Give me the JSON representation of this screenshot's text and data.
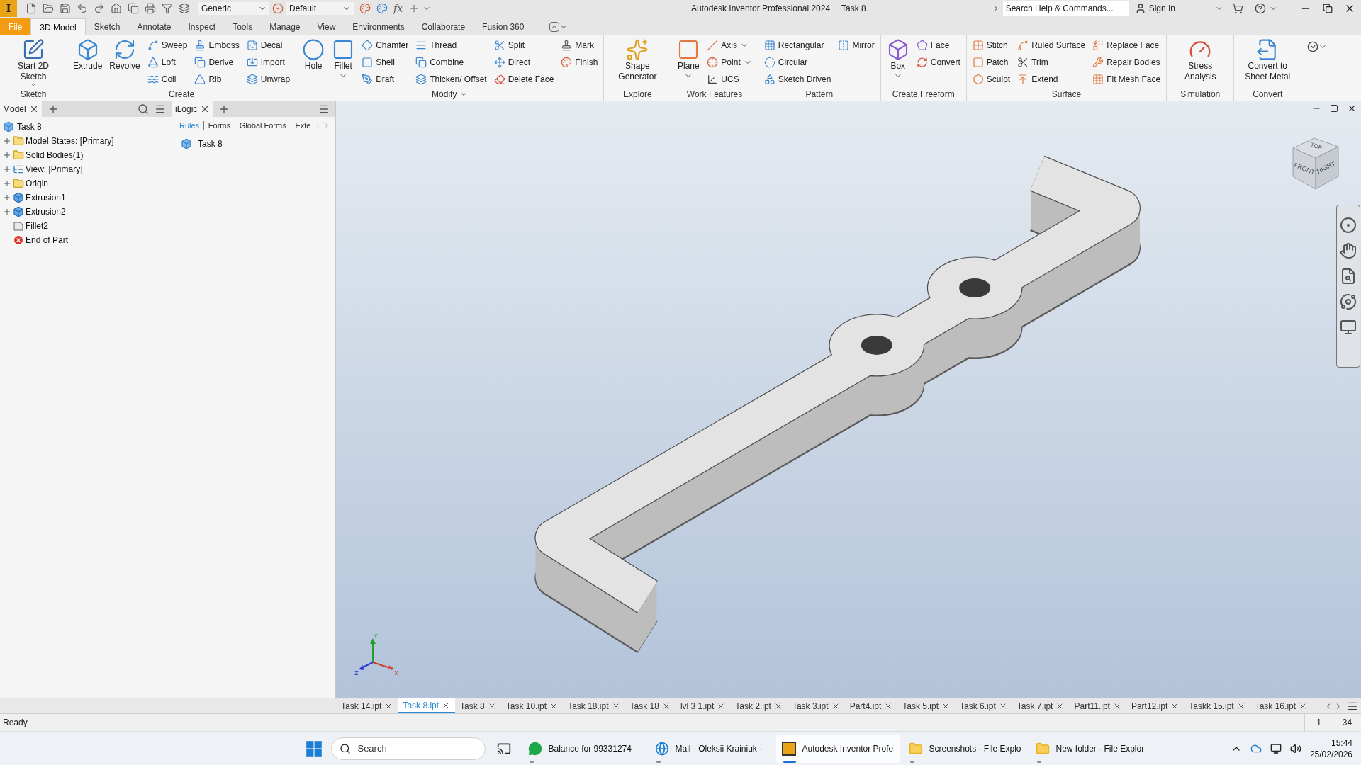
{
  "title_bar": {
    "logo_letter": "I",
    "material": "Generic",
    "appearance": "Default",
    "function_button": "fx",
    "app_title": "Autodesk Inventor Professional 2024",
    "document": "Task 8",
    "search": {
      "placeholder": "Search Help & Commands..."
    },
    "sign_in": "Sign In"
  },
  "ribbon_tabs": [
    {
      "label": "File",
      "kind": "file",
      "selected": false
    },
    {
      "label": "3D Model",
      "kind": "tab",
      "selected": true
    },
    {
      "label": "Sketch",
      "kind": "tab",
      "selected": false
    },
    {
      "label": "Annotate",
      "kind": "tab",
      "selected": false
    },
    {
      "label": "Inspect",
      "kind": "tab",
      "selected": false
    },
    {
      "label": "Tools",
      "kind": "tab",
      "selected": false
    },
    {
      "label": "Manage",
      "kind": "tab",
      "selected": false
    },
    {
      "label": "View",
      "kind": "tab",
      "selected": false
    },
    {
      "label": "Environments",
      "kind": "tab",
      "selected": false
    },
    {
      "label": "Collaborate",
      "kind": "tab",
      "selected": false
    },
    {
      "label": "Fusion 360",
      "kind": "tab",
      "selected": false
    }
  ],
  "ribbon_panels": [
    {
      "title": "Sketch",
      "menu": false,
      "columns": [
        [
          {
            "label": "Start 2D Sketch",
            "kind": "large-menu"
          }
        ]
      ]
    },
    {
      "title": "Create",
      "menu": false,
      "columns": [
        [
          {
            "label": "Extrude",
            "kind": "large"
          }
        ],
        [
          {
            "label": "Revolve",
            "kind": "large"
          }
        ],
        [
          {
            "label": "Sweep",
            "kind": "small"
          },
          {
            "label": "Loft",
            "kind": "small"
          },
          {
            "label": "Coil",
            "kind": "small"
          }
        ],
        [
          {
            "label": "Emboss",
            "kind": "small"
          },
          {
            "label": "Derive",
            "kind": "small"
          },
          {
            "label": "Rib",
            "kind": "small"
          }
        ],
        [
          {
            "label": "Decal",
            "kind": "small"
          },
          {
            "label": "Import",
            "kind": "small"
          },
          {
            "label": "Unwrap",
            "kind": "small"
          }
        ]
      ]
    },
    {
      "title": "Modify",
      "menu": true,
      "columns": [
        [
          {
            "label": "Hole",
            "kind": "large"
          }
        ],
        [
          {
            "label": "Fillet",
            "kind": "large-menu"
          }
        ],
        [
          {
            "label": "Chamfer",
            "kind": "small"
          },
          {
            "label": "Shell",
            "kind": "small"
          },
          {
            "label": "Draft",
            "kind": "small"
          }
        ],
        [
          {
            "label": "Thread",
            "kind": "small"
          },
          {
            "label": "Combine",
            "kind": "small"
          },
          {
            "label": "Thicken/ Offset",
            "kind": "small"
          }
        ],
        [
          {
            "label": "Split",
            "kind": "small"
          },
          {
            "label": "Direct",
            "kind": "small"
          },
          {
            "label": "Delete Face",
            "kind": "small"
          }
        ],
        [
          {
            "label": "Mark",
            "kind": "small"
          },
          {
            "label": "Finish",
            "kind": "small"
          }
        ]
      ]
    },
    {
      "title": "Explore",
      "menu": false,
      "columns": [
        [
          {
            "label": "Shape Generator",
            "kind": "large"
          }
        ]
      ]
    },
    {
      "title": "Work Features",
      "menu": false,
      "columns": [
        [
          {
            "label": "Plane",
            "kind": "large-menu"
          }
        ],
        [
          {
            "label": "Axis",
            "kind": "small-menu"
          },
          {
            "label": "Point",
            "kind": "small-menu"
          },
          {
            "label": "UCS",
            "kind": "small"
          }
        ]
      ]
    },
    {
      "title": "Pattern",
      "menu": false,
      "columns": [
        [
          {
            "label": "Rectangular",
            "kind": "small"
          },
          {
            "label": "Circular",
            "kind": "small"
          },
          {
            "label": "Sketch Driven",
            "kind": "small"
          }
        ],
        [
          {
            "label": "Mirror",
            "kind": "small"
          }
        ]
      ]
    },
    {
      "title": "Create Freeform",
      "menu": false,
      "columns": [
        [
          {
            "label": "Box",
            "kind": "large-menu"
          }
        ],
        [
          {
            "label": "Face",
            "kind": "small"
          },
          {
            "label": "Convert",
            "kind": "small"
          }
        ]
      ]
    },
    {
      "title": "Surface",
      "menu": false,
      "columns": [
        [
          {
            "label": "Stitch",
            "kind": "small"
          },
          {
            "label": "Patch",
            "kind": "small"
          },
          {
            "label": "Sculpt",
            "kind": "small"
          }
        ],
        [
          {
            "label": "Ruled Surface",
            "kind": "small"
          },
          {
            "label": "Trim",
            "kind": "small"
          },
          {
            "label": "Extend",
            "kind": "small"
          }
        ],
        [
          {
            "label": "Replace Face",
            "kind": "small"
          },
          {
            "label": "Repair Bodies",
            "kind": "small"
          },
          {
            "label": "Fit Mesh Face",
            "kind": "small"
          }
        ]
      ]
    },
    {
      "title": "Simulation",
      "menu": false,
      "columns": [
        [
          {
            "label": "Stress Analysis",
            "kind": "large"
          }
        ]
      ]
    },
    {
      "title": "Convert",
      "menu": false,
      "columns": [
        [
          {
            "label": "Convert to Sheet Metal",
            "kind": "large"
          }
        ]
      ]
    }
  ],
  "model_browser": {
    "tab": {
      "label": "Model",
      "selected": true
    },
    "tree": {
      "label": "Task 8",
      "kind": "part",
      "expandable": false,
      "children": [
        {
          "label": "Model States: [Primary]",
          "kind": "folder",
          "expandable": true
        },
        {
          "label": "Solid Bodies(1)",
          "kind": "bodies",
          "expandable": true
        },
        {
          "label": "View: [Primary]",
          "kind": "view",
          "expandable": true
        },
        {
          "label": "Origin",
          "kind": "folder",
          "expandable": true
        },
        {
          "label": "Extrusion1",
          "kind": "extrusion",
          "expandable": true
        },
        {
          "label": "Extrusion2",
          "kind": "extrusion",
          "expandable": true
        },
        {
          "label": "Fillet2",
          "kind": "fillet",
          "expandable": false
        },
        {
          "label": "End of Part",
          "kind": "end",
          "expandable": false
        }
      ]
    }
  },
  "ilogic_browser": {
    "tab": {
      "label": "iLogic",
      "selected": true
    },
    "subtabs": [
      {
        "label": "Rules",
        "selected": true
      },
      {
        "label": "Forms",
        "selected": false
      },
      {
        "label": "Global Forms",
        "selected": false
      },
      {
        "label": "Exte",
        "selected": false
      }
    ],
    "items": [
      "Task 8"
    ]
  },
  "viewport": {
    "view_cube": [
      "TOP",
      "FRONT",
      "RIGHT"
    ],
    "axis_labels": [
      "Y",
      "Z",
      "X"
    ]
  },
  "document_tabs": [
    {
      "label": "Task 14.ipt",
      "selected": false
    },
    {
      "label": "Task 8.ipt",
      "selected": true
    },
    {
      "label": "Task 8",
      "selected": false
    },
    {
      "label": "Task 10.ipt",
      "selected": false
    },
    {
      "label": "Task 18.ipt",
      "selected": false
    },
    {
      "label": "Task 18",
      "selected": false
    },
    {
      "label": "lvl 3 1.ipt",
      "selected": false
    },
    {
      "label": "Task 2.ipt",
      "selected": false
    },
    {
      "label": "Task 3.ipt",
      "selected": false
    },
    {
      "label": "Part4.ipt",
      "selected": false
    },
    {
      "label": "Task 5.ipt",
      "selected": false
    },
    {
      "label": "Task 6.ipt",
      "selected": false
    },
    {
      "label": "Task 7.ipt",
      "selected": false
    },
    {
      "label": "Part11.ipt",
      "selected": false
    },
    {
      "label": "Part12.ipt",
      "selected": false
    },
    {
      "label": "Taskk 15.ipt",
      "selected": false
    },
    {
      "label": "Task 16.ipt",
      "selected": false
    }
  ],
  "status_bar": {
    "message": "Ready",
    "cells": [
      "1",
      "34"
    ]
  },
  "taskbar": {
    "search": {
      "placeholder": "Search"
    },
    "apps": [
      {
        "label": "Balance for 99331274",
        "kind": "chat",
        "selected": false
      },
      {
        "label": "Mail - Oleksii Krainiuk -",
        "kind": "browser",
        "selected": false
      },
      {
        "label": "Autodesk Inventor Profe",
        "kind": "inventor",
        "selected": true
      },
      {
        "label": "Screenshots - File Explo",
        "kind": "explorer",
        "selected": false
      },
      {
        "label": "New folder - File Explor",
        "kind": "explorer",
        "selected": false
      }
    ],
    "time": "15:44",
    "date": "25/02/2026"
  }
}
